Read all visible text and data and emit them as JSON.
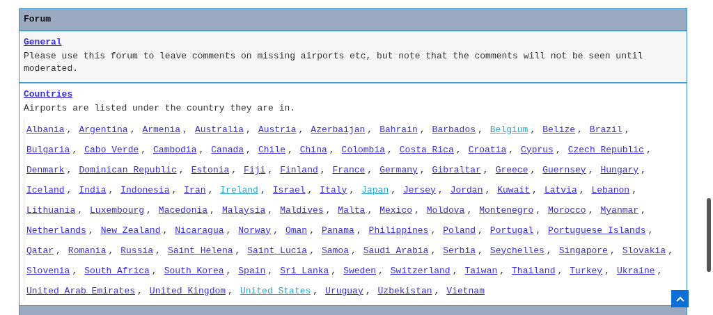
{
  "forum": {
    "title": "Forum",
    "sections": [
      {
        "kind": "text",
        "title": "General",
        "description": "Please use this forum to leave comments on missing airports etc, but note that the comments will not be seen until moderated."
      },
      {
        "kind": "links",
        "title": "Countries",
        "description": "Airports are listed under the country they are in.",
        "separator": ",",
        "links": [
          {
            "label": "Albania",
            "visited": false
          },
          {
            "label": "Argentina",
            "visited": false
          },
          {
            "label": "Armenia",
            "visited": false
          },
          {
            "label": "Australia",
            "visited": false
          },
          {
            "label": "Austria",
            "visited": false
          },
          {
            "label": "Azerbaijan",
            "visited": false
          },
          {
            "label": "Bahrain",
            "visited": false
          },
          {
            "label": "Barbados",
            "visited": false
          },
          {
            "label": "Belgium",
            "visited": true
          },
          {
            "label": "Belize",
            "visited": false
          },
          {
            "label": "Brazil",
            "visited": false
          },
          {
            "label": "Bulgaria",
            "visited": false
          },
          {
            "label": "Cabo Verde",
            "visited": false
          },
          {
            "label": "Cambodia",
            "visited": false
          },
          {
            "label": "Canada",
            "visited": false
          },
          {
            "label": "Chile",
            "visited": false
          },
          {
            "label": "China",
            "visited": false
          },
          {
            "label": "Colombia",
            "visited": false
          },
          {
            "label": "Costa Rica",
            "visited": false
          },
          {
            "label": "Croatia",
            "visited": false
          },
          {
            "label": "Cyprus",
            "visited": false
          },
          {
            "label": "Czech Republic",
            "visited": false
          },
          {
            "label": "Denmark",
            "visited": false
          },
          {
            "label": "Dominican Republic",
            "visited": false
          },
          {
            "label": "Estonia",
            "visited": false
          },
          {
            "label": "Fiji",
            "visited": false
          },
          {
            "label": "Finland",
            "visited": false
          },
          {
            "label": "France",
            "visited": false
          },
          {
            "label": "Germany",
            "visited": false
          },
          {
            "label": "Gibraltar",
            "visited": false
          },
          {
            "label": "Greece",
            "visited": false
          },
          {
            "label": "Guernsey",
            "visited": false
          },
          {
            "label": "Hungary",
            "visited": false
          },
          {
            "label": "Iceland",
            "visited": false
          },
          {
            "label": "India",
            "visited": false
          },
          {
            "label": "Indonesia",
            "visited": false
          },
          {
            "label": "Iran",
            "visited": false
          },
          {
            "label": "Ireland",
            "visited": true
          },
          {
            "label": "Israel",
            "visited": false
          },
          {
            "label": "Italy",
            "visited": false
          },
          {
            "label": "Japan",
            "visited": true
          },
          {
            "label": "Jersey",
            "visited": false
          },
          {
            "label": "Jordan",
            "visited": false
          },
          {
            "label": "Kuwait",
            "visited": false
          },
          {
            "label": "Latvia",
            "visited": false
          },
          {
            "label": "Lebanon",
            "visited": false
          },
          {
            "label": "Lithuania",
            "visited": false
          },
          {
            "label": "Luxembourg",
            "visited": false
          },
          {
            "label": "Macedonia",
            "visited": false
          },
          {
            "label": "Malaysia",
            "visited": false
          },
          {
            "label": "Maldives",
            "visited": false
          },
          {
            "label": "Malta",
            "visited": false
          },
          {
            "label": "Mexico",
            "visited": false
          },
          {
            "label": "Moldova",
            "visited": false
          },
          {
            "label": "Montenegro",
            "visited": false
          },
          {
            "label": "Morocco",
            "visited": false
          },
          {
            "label": "Myanmar",
            "visited": false
          },
          {
            "label": "Netherlands",
            "visited": false
          },
          {
            "label": "New Zealand",
            "visited": false
          },
          {
            "label": "Nicaragua",
            "visited": false
          },
          {
            "label": "Norway",
            "visited": false
          },
          {
            "label": "Oman",
            "visited": false
          },
          {
            "label": "Panama",
            "visited": false
          },
          {
            "label": "Philippines",
            "visited": false
          },
          {
            "label": "Poland",
            "visited": false
          },
          {
            "label": "Portugal",
            "visited": false
          },
          {
            "label": "Portuguese Islands",
            "visited": false
          },
          {
            "label": "Qatar",
            "visited": false
          },
          {
            "label": "Romania",
            "visited": false
          },
          {
            "label": "Russia",
            "visited": false
          },
          {
            "label": "Saint Helena",
            "visited": false
          },
          {
            "label": "Saint Lucia",
            "visited": false
          },
          {
            "label": "Samoa",
            "visited": false
          },
          {
            "label": "Saudi Arabia",
            "visited": false
          },
          {
            "label": "Serbia",
            "visited": false
          },
          {
            "label": "Seychelles",
            "visited": false
          },
          {
            "label": "Singapore",
            "visited": false
          },
          {
            "label": "Slovakia",
            "visited": false
          },
          {
            "label": "Slovenia",
            "visited": false
          },
          {
            "label": "South Africa",
            "visited": false
          },
          {
            "label": "South Korea",
            "visited": false
          },
          {
            "label": "Spain",
            "visited": false
          },
          {
            "label": "Sri Lanka",
            "visited": false
          },
          {
            "label": "Sweden",
            "visited": false
          },
          {
            "label": "Switzerland",
            "visited": false
          },
          {
            "label": "Taiwan",
            "visited": false
          },
          {
            "label": "Thailand",
            "visited": false
          },
          {
            "label": "Turkey",
            "visited": false
          },
          {
            "label": "Ukraine",
            "visited": false
          },
          {
            "label": "United Arab Emirates",
            "visited": false
          },
          {
            "label": "United Kingdom",
            "visited": false
          },
          {
            "label": "United States",
            "visited": true
          },
          {
            "label": "Uruguay",
            "visited": false
          },
          {
            "label": "Uzbekistan",
            "visited": false
          },
          {
            "label": "Vietnam",
            "visited": false
          }
        ]
      }
    ]
  }
}
